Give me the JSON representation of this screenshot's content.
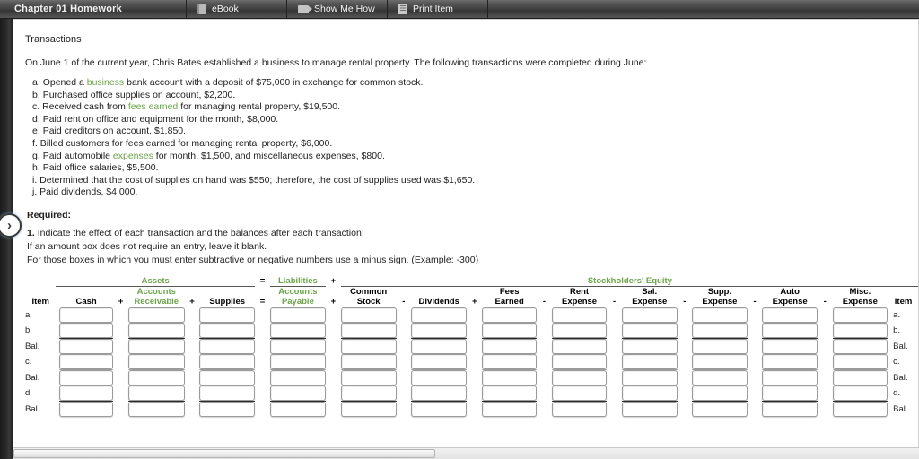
{
  "header": {
    "title": "Chapter 01 Homework",
    "tabs": [
      {
        "label": "eBook",
        "icon": "book-icon"
      },
      {
        "label": "Show Me How",
        "icon": "video-camera-icon"
      },
      {
        "label": "Print Item",
        "icon": "document-icon"
      }
    ]
  },
  "colors": {
    "accent_green": "#6ba54a",
    "header_dark": "#3f3f3f",
    "rule": "#555555"
  },
  "left_rail": {
    "expander_glyph": "›"
  },
  "content": {
    "section_title": "Transactions",
    "intro": "On June 1 of the current year, Chris Bates established a business to manage rental property. The following transactions were completed during June:",
    "transactions": [
      {
        "letter": "a.",
        "pre": "Opened a ",
        "link": "business",
        "post": " bank account with a deposit of $75,000 in exchange for common stock."
      },
      {
        "letter": "b.",
        "pre": "Purchased office supplies on account, $2,200.",
        "link": "",
        "post": ""
      },
      {
        "letter": "c.",
        "pre": "Received cash from ",
        "link": "fees earned",
        "post": " for managing rental property, $19,500."
      },
      {
        "letter": "d.",
        "pre": "Paid rent on office and equipment for the month, $8,000.",
        "link": "",
        "post": ""
      },
      {
        "letter": "e.",
        "pre": "Paid creditors on account, $1,850.",
        "link": "",
        "post": ""
      },
      {
        "letter": "f.",
        "pre": "Billed customers for fees earned for managing rental property, $6,000.",
        "link": "",
        "post": ""
      },
      {
        "letter": "g.",
        "pre": "Paid automobile ",
        "link": "expenses",
        "post": " for month, $1,500, and miscellaneous expenses, $800."
      },
      {
        "letter": "h.",
        "pre": "Paid office salaries, $5,500.",
        "link": "",
        "post": ""
      },
      {
        "letter": "i.",
        "pre": "Determined that the cost of supplies on hand was $550; therefore, the cost of supplies used was $1,650.",
        "link": "",
        "post": ""
      },
      {
        "letter": "j.",
        "pre": "Paid dividends, $4,000.",
        "link": "",
        "post": ""
      }
    ],
    "required_label": "Required:",
    "req_num": "1.",
    "req_text": "Indicate the effect of each transaction and the balances after each transaction:",
    "note1": "If an amount box does not require an entry, leave it blank.",
    "note2": "For those boxes in which you must enter subtractive or negative numbers use a minus sign. (Example: -300)"
  },
  "table": {
    "groups": [
      {
        "label": "Assets",
        "color": "green"
      },
      {
        "label": "=",
        "color": "black"
      },
      {
        "label": "Liabilities",
        "color": "green"
      },
      {
        "label": "+",
        "color": "black"
      },
      {
        "label": "Stockholders' Equity",
        "color": "green"
      }
    ],
    "item_header_left": "Item",
    "item_header_right": "Item",
    "columns": [
      {
        "line1": "",
        "line2": "Cash",
        "green": false,
        "op_before": ""
      },
      {
        "line1": "Accounts",
        "line2": "Receivable",
        "green": true,
        "op_before": "+"
      },
      {
        "line1": "",
        "line2": "Supplies",
        "green": false,
        "op_before": "+"
      },
      {
        "line1": "Accounts",
        "line2": "Payable",
        "green": true,
        "op_before": "="
      },
      {
        "line1": "Common",
        "line2": "Stock",
        "green": false,
        "op_before": "+"
      },
      {
        "line1": "",
        "line2": "Dividends",
        "green": false,
        "op_before": "-"
      },
      {
        "line1": "Fees",
        "line2": "Earned",
        "green": false,
        "op_before": "+"
      },
      {
        "line1": "Rent",
        "line2": "Expense",
        "green": false,
        "op_before": "-"
      },
      {
        "line1": "Sal.",
        "line2": "Expense",
        "green": false,
        "op_before": "-"
      },
      {
        "line1": "Supp.",
        "line2": "Expense",
        "green": false,
        "op_before": "-"
      },
      {
        "line1": "Auto",
        "line2": "Expense",
        "green": false,
        "op_before": "-"
      },
      {
        "line1": "Misc.",
        "line2": "Expense",
        "green": false,
        "op_before": "-"
      }
    ],
    "rows": [
      {
        "label": "a.",
        "rule": "none",
        "values": [
          "",
          "",
          "",
          "",
          "",
          "",
          "",
          "",
          "",
          "",
          "",
          ""
        ]
      },
      {
        "label": "b.",
        "rule": "none",
        "values": [
          "",
          "",
          "",
          "",
          "",
          "",
          "",
          "",
          "",
          "",
          "",
          ""
        ]
      },
      {
        "label": "Bal.",
        "rule": "dark",
        "values": [
          "",
          "",
          "",
          "",
          "",
          "",
          "",
          "",
          "",
          "",
          "",
          ""
        ]
      },
      {
        "label": "c.",
        "rule": "none",
        "values": [
          "",
          "",
          "",
          "",
          "",
          "",
          "",
          "",
          "",
          "",
          "",
          ""
        ]
      },
      {
        "label": "Bal.",
        "rule": "light",
        "values": [
          "",
          "",
          "",
          "",
          "",
          "",
          "",
          "",
          "",
          "",
          "",
          ""
        ]
      },
      {
        "label": "d.",
        "rule": "none",
        "values": [
          "",
          "",
          "",
          "",
          "",
          "",
          "",
          "",
          "",
          "",
          "",
          ""
        ]
      },
      {
        "label": "Bal.",
        "rule": "dark",
        "values": [
          "",
          "",
          "",
          "",
          "",
          "",
          "",
          "",
          "",
          "",
          "",
          ""
        ]
      }
    ],
    "input_placeholder": ""
  },
  "scrollbar": {
    "orientation": "horizontal"
  }
}
